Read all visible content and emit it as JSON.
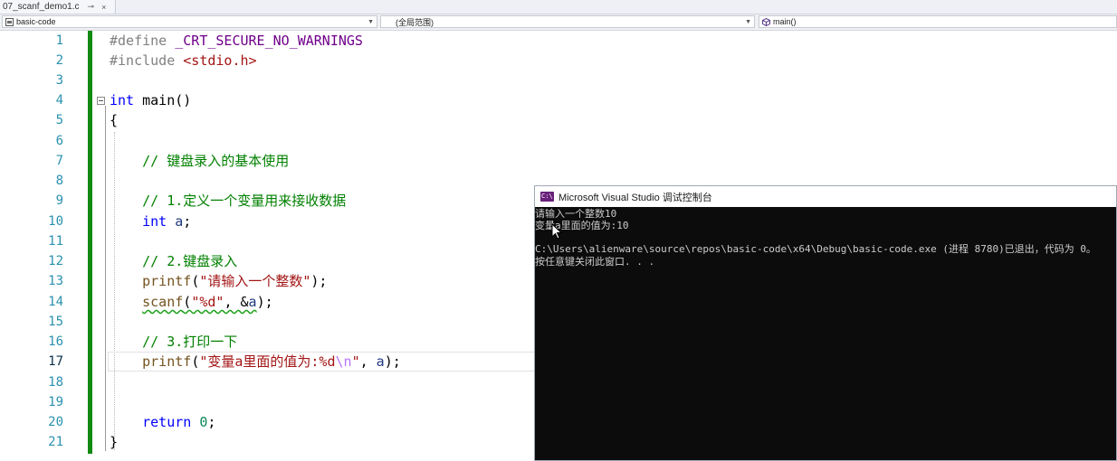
{
  "tab": {
    "title": "07_scanf_demo1.c",
    "pin": "⊸",
    "close": "×"
  },
  "navbar": {
    "project": "basic-code",
    "scope": "(全局范围)",
    "member": "main()"
  },
  "editor": {
    "current_line": 17,
    "line_numbers": [
      "1",
      "2",
      "3",
      "4",
      "5",
      "6",
      "7",
      "8",
      "9",
      "10",
      "11",
      "12",
      "13",
      "14",
      "15",
      "16",
      "17",
      "18",
      "19",
      "20",
      "21"
    ],
    "lines": {
      "l1_directive": "#define",
      "l1_macro": "_CRT_SECURE_NO_WARNINGS",
      "l2_directive": "#include",
      "l2_header": "<stdio.h>",
      "l4_type": "int",
      "l4_name": "main()",
      "l5": "{",
      "l7_comment": "// 键盘录入的基本使用",
      "l9_comment": "// 1.定义一个变量用来接收数据",
      "l10_type": "int",
      "l10_var": "a",
      "l10_end": ";",
      "l12_comment": "// 2.键盘录入",
      "l13_fn": "printf",
      "l13_open": "(",
      "l13_str": "\"请输入一个整数\"",
      "l13_close": ");",
      "l14_fn": "scanf",
      "l14_open": "(",
      "l14_str": "\"%d\"",
      "l14_mid": ", &",
      "l14_var": "a",
      "l14_close": ");",
      "l16_comment": "// 3.打印一下",
      "l17_fn": "printf",
      "l17_open": "(",
      "l17_str1": "\"变量a里面的值为:%d",
      "l17_esc": "\\n",
      "l17_str2": "\"",
      "l17_mid": ", ",
      "l17_var": "a",
      "l17_close": ");",
      "l20_kw": "return",
      "l20_num": "0",
      "l20_end": ";",
      "l21": "}"
    }
  },
  "console": {
    "title": "Microsoft Visual Studio 调试控制台",
    "icon_label": "C:\\",
    "lines": [
      "请输入一个整数10",
      "变量a里面的值为:10",
      "",
      "C:\\Users\\alienware\\source\\repos\\basic-code\\x64\\Debug\\basic-code.exe (进程 8780)已退出，代码为 0。",
      "按任意键关闭此窗口. . ."
    ]
  },
  "colors": {
    "keyword": "#0000ff",
    "comment": "#008000",
    "string": "#a31515",
    "line_number": "#2b91af",
    "change_bar": "#108a10",
    "console_bg": "#0c0c0c"
  },
  "icons": {
    "project": "c-project-icon",
    "member": "cube-method-icon",
    "console": "vs-console-icon",
    "cursor": "mouse-pointer-icon"
  }
}
